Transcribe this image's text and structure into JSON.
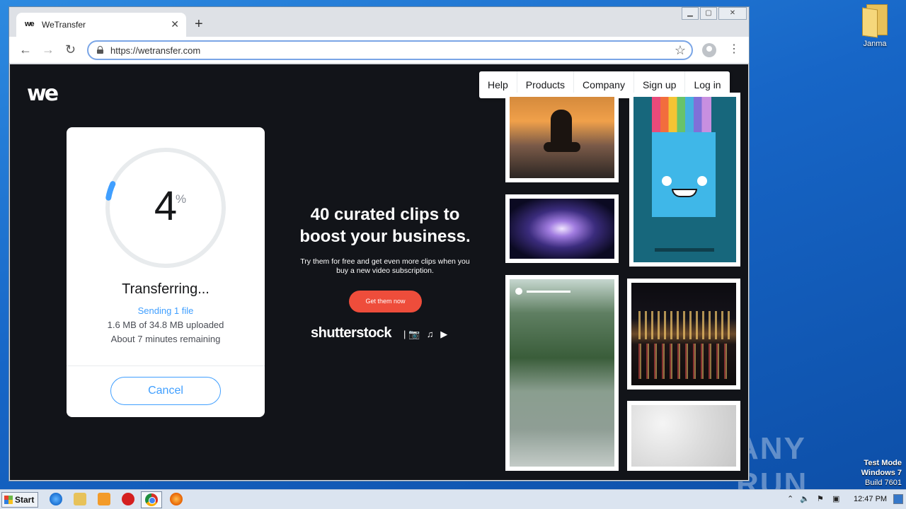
{
  "browser": {
    "tab_title": "WeTransfer",
    "tab_favicon": "we",
    "url": "https://wetransfer.com",
    "new_tab_label": "+",
    "close_tab_label": "✕"
  },
  "page": {
    "logo": "we",
    "nav": [
      "Help",
      "Products",
      "Company",
      "Sign up",
      "Log in"
    ],
    "transfer": {
      "progress_percent": 4,
      "percent_number": "4",
      "percent_sign": "%",
      "title": "Transferring...",
      "sending": "Sending 1 file",
      "uploaded": "1.6 MB of 34.8 MB uploaded",
      "remaining": "About 7 minutes remaining",
      "cancel_label": "Cancel"
    },
    "ad": {
      "headline": "40 curated clips to boost your business.",
      "body": "Try them for free and get even more clips when you buy a new video subscription.",
      "cta": "Get them now",
      "brand": "shutterstock",
      "media_icons": [
        "camera-icon",
        "music-icon",
        "video-icon"
      ]
    }
  },
  "desktop": {
    "folder_label": "Janma",
    "watermark": "ANY RUN",
    "test_mode_line1": "Test Mode",
    "test_mode_line2": "Windows 7",
    "test_mode_line3": "Build 7601"
  },
  "taskbar": {
    "start_label": "Start",
    "clock": "12:47 PM"
  },
  "colors": {
    "accent": "#409fff",
    "cta": "#ee4d3b",
    "page_bg": "#121419"
  }
}
